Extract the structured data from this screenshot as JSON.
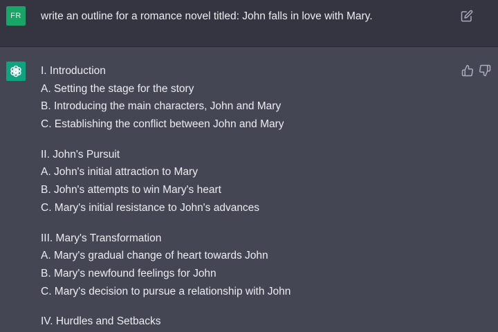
{
  "user_message": {
    "avatar_initials": "FR",
    "text": "write an outline for a romance novel titled: John falls in love with Mary.",
    "edit_icon": "edit-icon"
  },
  "assistant_message": {
    "avatar_icon": "openai-logo-icon",
    "feedback_icons": [
      "thumbs-up-icon",
      "thumbs-down-icon"
    ],
    "sections": [
      {
        "heading": "I. Introduction",
        "items": [
          "A. Setting the stage for the story",
          "B. Introducing the main characters, John and Mary",
          "C. Establishing the conflict between John and Mary"
        ]
      },
      {
        "heading": "II. John's Pursuit",
        "items": [
          "A. John's initial attraction to Mary",
          "B. John's attempts to win Mary's heart",
          "C. Mary's initial resistance to John's advances"
        ]
      },
      {
        "heading": "III. Mary's Transformation",
        "items": [
          "A. Mary's gradual change of heart towards John",
          "B. Mary's newfound feelings for John",
          "C. Mary's decision to pursue a relationship with John"
        ]
      },
      {
        "heading": "IV. Hurdles and Setbacks",
        "items": []
      }
    ]
  },
  "colors": {
    "user_bg": "#343541",
    "assistant_bg": "#444654",
    "user_avatar": "#19a468",
    "bot_avatar": "#10a37f",
    "text": "#ececf1"
  }
}
